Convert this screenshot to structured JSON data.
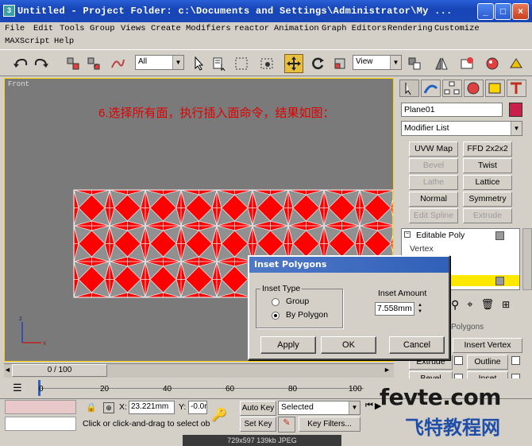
{
  "window": {
    "title": "Untitled   - Project Folder: c:\\Documents and Settings\\Administrator\\My ...",
    "icon": "3ds-max-icon"
  },
  "menu": [
    "File",
    "Edit",
    "Tools",
    "Group",
    "Views",
    "Create",
    "Modifiers",
    "reactor",
    "Animation",
    "Graph Editors",
    "Rendering",
    "Customize",
    "MAXScript",
    "Help"
  ],
  "toolbar": {
    "selection_filter": "All",
    "ref_coord": "View"
  },
  "viewport": {
    "label": "Front",
    "caption": "6.选择所有面，执行插入面命令，结果如图：",
    "axes": {
      "x": "x",
      "z": "z"
    }
  },
  "panel": {
    "object_name": "Plane01",
    "object_color": "#c8204a",
    "modifier_list": "Modifier List",
    "buttons": [
      {
        "label": "UVW Map",
        "enabled": true
      },
      {
        "label": "FFD 2x2x2",
        "enabled": true
      },
      {
        "label": "Bevel",
        "enabled": false
      },
      {
        "label": "Twist",
        "enabled": true
      },
      {
        "label": "Lathe",
        "enabled": false
      },
      {
        "label": "Lattice",
        "enabled": true
      },
      {
        "label": "Normal",
        "enabled": true
      },
      {
        "label": "Symmetry",
        "enabled": true
      },
      {
        "label": "Edit Spline",
        "enabled": false
      },
      {
        "label": "Extrude",
        "enabled": false
      }
    ],
    "stack": {
      "top": "Editable Poly",
      "sub": "Vertex"
    },
    "rollout_title": "Polygons",
    "insert_vertex": "Insert Vertex",
    "extrude": "Extrude",
    "outline": "Outline",
    "bevel": "Bevel",
    "inset": "Inset"
  },
  "dialog": {
    "title": "Inset Polygons",
    "group_label": "Inset Type",
    "options": [
      "Group",
      "By Polygon"
    ],
    "selected": "By Polygon",
    "amount_label": "Inset Amount",
    "amount_value": "7.558mm",
    "apply": "Apply",
    "ok": "OK",
    "cancel": "Cancel"
  },
  "timeline": {
    "frame": "0 / 100",
    "ticks": [
      "0",
      "20",
      "40",
      "60",
      "80",
      "100"
    ]
  },
  "status": {
    "x_label": "X:",
    "x_value": "23.221mm",
    "y_label": "Y:",
    "y_value": "-0.0r",
    "auto_key": "Auto Key",
    "set_key": "Set Key",
    "selected": "Selected",
    "key_filters": "Key Filters...",
    "prompt": "Click or click-and-drag to select ob"
  },
  "footer": "729x597  139kb  JPEG",
  "watermark": {
    "line1": "fevte.com",
    "line2": "飞特教程网"
  },
  "colors": {
    "accent": "#ffd400",
    "poly_fill": "#ff0000",
    "title_blue": "#1846b8"
  }
}
